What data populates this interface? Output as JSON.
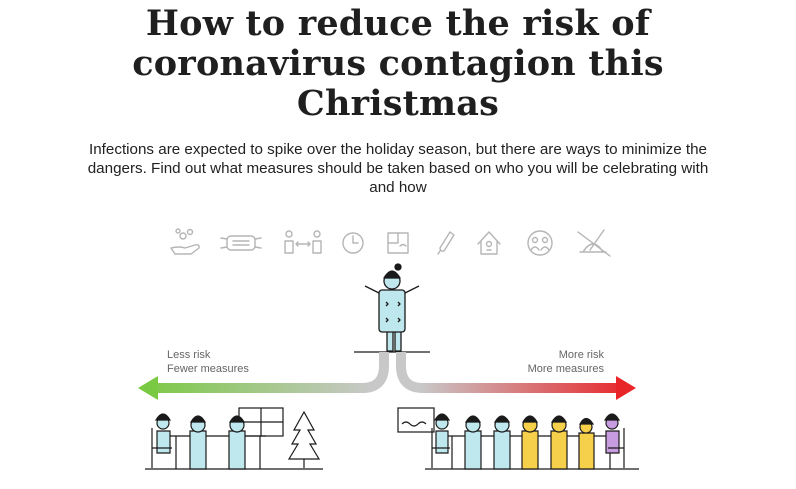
{
  "article": {
    "title_lines": [
      "How to reduce the risk of",
      "coronavirus contagion this",
      "Christmas"
    ],
    "lead_lines": [
      "Infections are expected to spike over the holiday season, but there are ways to minimize the",
      "dangers. Find out what measures should be taken based on who you will be celebrating with",
      "and how"
    ]
  },
  "measures": {
    "icons": [
      "hand-wash-icon",
      "face-mask-icon",
      "distance-icon",
      "clock-icon",
      "window-ventilation-icon",
      "thermometer-icon",
      "house-icon",
      "household-bubble-icon",
      "no-eating-icon"
    ]
  },
  "scale": {
    "left": {
      "line1": "Less risk",
      "line2": "Fewer measures",
      "color": "#7ac943"
    },
    "right": {
      "line1": "More risk",
      "line2": "More measures",
      "color": "#e8262a"
    }
  },
  "colors": {
    "person_light": "#bfe7ee",
    "person_yellow": "#f6d04a",
    "person_purple": "#c89ce0",
    "outline": "#1a1a1a",
    "icon_gray": "#b5b5b5"
  }
}
